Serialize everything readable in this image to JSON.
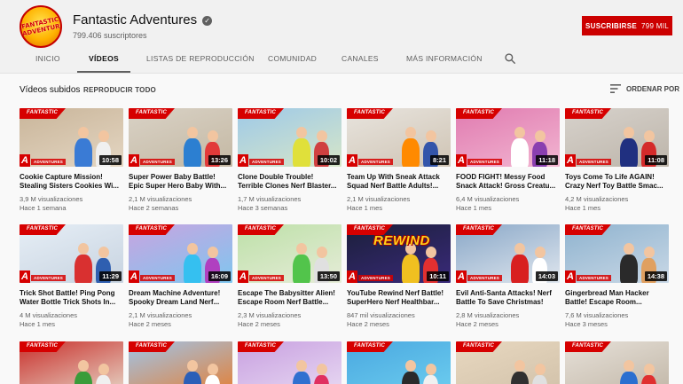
{
  "channel": {
    "name": "Fantastic Adventures",
    "subscribers": "799.406 suscriptores",
    "avatar_text": "FANTASTIC ADVENTURES!",
    "subscribe_label": "SUSCRIBIRSE",
    "subscribe_count": "799 MIL"
  },
  "tabs": [
    {
      "label": "INICIO",
      "active": false
    },
    {
      "label": "VÍDEOS",
      "active": true
    },
    {
      "label": "LISTAS DE REPRODUCCIÓN",
      "active": false
    },
    {
      "label": "COMUNIDAD",
      "active": false
    },
    {
      "label": "CANALES",
      "active": false
    },
    {
      "label": "MÁS INFORMACIÓN",
      "active": false
    }
  ],
  "section": {
    "title": "Vídeos subidos",
    "play_all": "REPRODUCIR TODO",
    "sort_label": "ORDENAR POR"
  },
  "brand": {
    "top": "FANTASTIC",
    "bottom": "ADVENTURES",
    "letter": "A"
  },
  "colors": {
    "subscribe": "#cc0000",
    "brand_red": "#d60000"
  },
  "videos": [
    {
      "title1": "Cookie Capture Mission!",
      "title2": "Stealing Sisters Cookies Wi...",
      "views": "3,9 M visualizaciones",
      "age": "Hace 1 semana",
      "duration": "10:58"
    },
    {
      "title1": "Super Power Baby Battle!",
      "title2": "Epic Super Hero Baby With...",
      "views": "2,1 M visualizaciones",
      "age": "Hace 2 semanas",
      "duration": "13:26"
    },
    {
      "title1": "Clone Double Trouble!",
      "title2": "Terrible Clones Nerf Blaster...",
      "views": "1,7 M visualizaciones",
      "age": "Hace 3 semanas",
      "duration": "10:02"
    },
    {
      "title1": "Team Up With Sneak Attack",
      "title2": "Squad Nerf Battle Adults!...",
      "views": "2,1 M visualizaciones",
      "age": "Hace 1 mes",
      "duration": "8:21"
    },
    {
      "title1": "FOOD FIGHT! Messy Food",
      "title2": "Snack Attack! Gross Creatu...",
      "views": "6,4 M visualizaciones",
      "age": "Hace 1 mes",
      "duration": "11:18"
    },
    {
      "title1": "Toys Come To Life AGAIN!",
      "title2": "Crazy Nerf Toy Battle Smac...",
      "views": "4,2 M visualizaciones",
      "age": "Hace 1 mes",
      "duration": "11:08"
    },
    {
      "title1": "Trick Shot Battle! Ping Pong",
      "title2": "Water Bottle Trick Shots In...",
      "views": "4 M visualizaciones",
      "age": "Hace 1 mes",
      "duration": "11:29"
    },
    {
      "title1": "Dream Machine Adventure!",
      "title2": "Spooky Dream Land Nerf...",
      "views": "2,1 M visualizaciones",
      "age": "Hace 2 meses",
      "duration": "16:09"
    },
    {
      "title1": "Escape The Babysitter Alien!",
      "title2": "Escape Room Nerf Battle...",
      "views": "2,3 M visualizaciones",
      "age": "Hace 2 meses",
      "duration": "13:50"
    },
    {
      "title1": "YouTube Rewind Nerf Battle!",
      "title2": "SuperHero Nerf Healthbar...",
      "views": "847 mil visualizaciones",
      "age": "Hace 2 meses",
      "duration": "10:11",
      "overlay": "REWIND"
    },
    {
      "title1": "Evil Anti-Santa Attacks! Nerf",
      "title2": "Battle To Save Christmas!",
      "views": "2,8 M visualizaciones",
      "age": "Hace 2 meses",
      "duration": "14:03"
    },
    {
      "title1": "Gingerbread Man Hacker",
      "title2": "Battle! Escape Room...",
      "views": "7,6 M visualizaciones",
      "age": "Hace 3 meses",
      "duration": "14:38"
    },
    {
      "title1": "",
      "title2": "",
      "views": "",
      "age": "",
      "duration": ""
    },
    {
      "title1": "",
      "title2": "",
      "views": "",
      "age": "",
      "duration": ""
    },
    {
      "title1": "",
      "title2": "",
      "views": "",
      "age": "",
      "duration": ""
    },
    {
      "title1": "",
      "title2": "",
      "views": "",
      "age": "",
      "duration": ""
    },
    {
      "title1": "",
      "title2": "",
      "views": "",
      "age": "",
      "duration": ""
    },
    {
      "title1": "",
      "title2": "",
      "views": "",
      "age": "",
      "duration": ""
    }
  ]
}
